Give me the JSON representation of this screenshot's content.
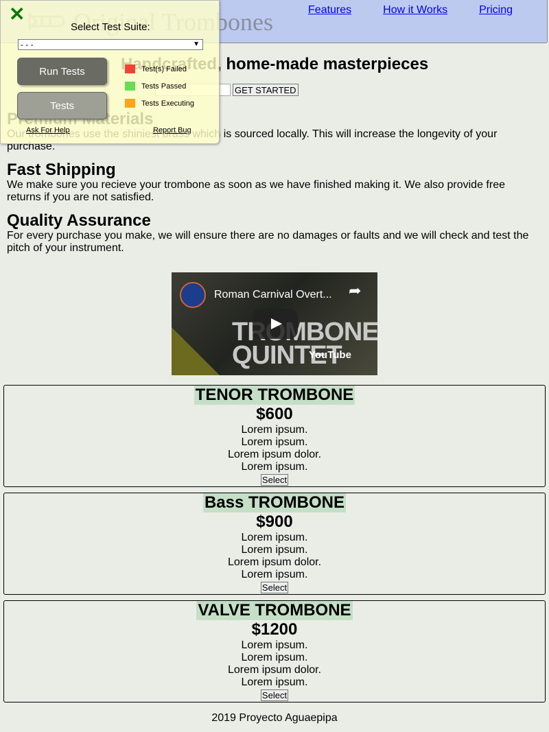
{
  "header": {
    "logo_text": "Original Trombones",
    "nav": [
      "Features",
      "How it Works",
      "Pricing"
    ]
  },
  "hero": {
    "title": "Handcrafted, home-made masterpieces",
    "button": "GET STARTED"
  },
  "features": [
    {
      "title": "Premium Materials",
      "text": "Our trombones use the shiniest brass which is sourced locally. This will increase the longevity of your purchase."
    },
    {
      "title": "Fast Shipping",
      "text": "We make sure you recieve your trombone as soon as we have finished making it. We also provide free returns if you are not satisfied."
    },
    {
      "title": "Quality Assurance",
      "text": "For every purchase you make, we will ensure there are no damages or faults and we will check and test the pitch of your instrument."
    }
  ],
  "video": {
    "title": "Roman Carnival Overt...",
    "overlay_text": "TROMBONE QUINTET",
    "brand": "YouTube"
  },
  "pricing": [
    {
      "name": "TENOR TROMBONE",
      "price": "$600",
      "lines": [
        "Lorem ipsum.",
        "Lorem ipsum.",
        "Lorem ipsum dolor.",
        "Lorem ipsum."
      ],
      "button": "Select"
    },
    {
      "name": "Bass TROMBONE",
      "price": "$900",
      "lines": [
        "Lorem ipsum.",
        "Lorem ipsum.",
        "Lorem ipsum dolor.",
        "Lorem ipsum."
      ],
      "button": "Select"
    },
    {
      "name": "VALVE TROMBONE",
      "price": "$1200",
      "lines": [
        "Lorem ipsum.",
        "Lorem ipsum.",
        "Lorem ipsum dolor.",
        "Lorem ipsum."
      ],
      "button": "Select"
    }
  ],
  "footer": "2019 Proyecto Aguaepipa",
  "test_panel": {
    "close_icon": "close-icon",
    "suite_label": "Select Test Suite:",
    "suite_value": "- - -",
    "run_button": "Run Tests",
    "tests_button": "Tests",
    "legend": [
      {
        "label": "Test(s) Failed",
        "color": "#f44336"
      },
      {
        "label": "Tests Passed",
        "color": "#66dd55"
      },
      {
        "label": "Tests Executing",
        "color": "#ffa31a"
      }
    ],
    "help_link": "Ask For Help",
    "bug_link": "Report Bug"
  },
  "colors": {
    "header_bg": "#bccaf0",
    "page_bg": "#eaede6",
    "card_name_bg": "#c4dfc6",
    "link": "#0000ee"
  }
}
